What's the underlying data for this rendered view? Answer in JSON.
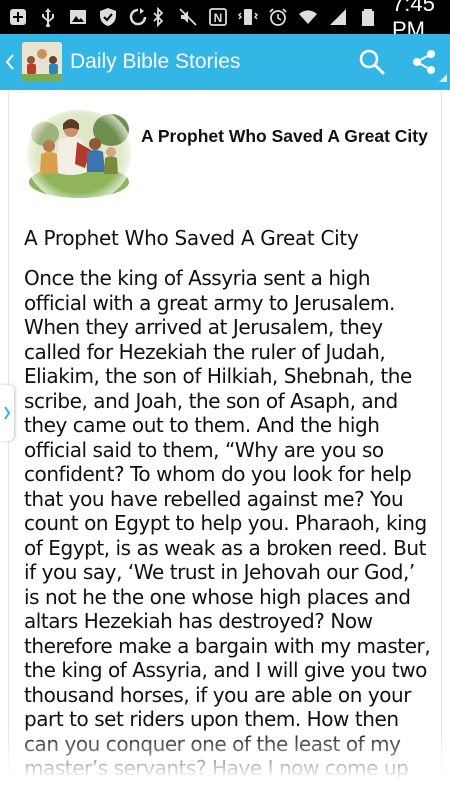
{
  "status_bar": {
    "time": "7:45 PM",
    "left_icons": [
      "add-icon",
      "usb-icon",
      "image-icon",
      "shield-icon",
      "sync-icon"
    ],
    "right_icons": [
      "bluetooth-icon",
      "mute-icon",
      "nfc-icon",
      "vibrate-icon",
      "alarm-icon",
      "wifi-icon",
      "signal-icon",
      "battery-icon"
    ]
  },
  "app_bar": {
    "title": "Daily Bible Stories",
    "background_color": "#33b5e5",
    "actions": [
      "search-icon",
      "share-icon"
    ]
  },
  "story": {
    "heading": "A Prophet Who Saved A Great City",
    "title": "A Prophet Who Saved A Great City",
    "body": "Once the king of Assyria sent a high official with a great army to Jerusalem. When they arrived at Jerusalem, they called for Hezekiah the ruler of Judah, Eliakim, the son of Hilkiah, Shebnah, the scribe, and Joah, the son of Asaph, and they came out to them. And the high official said to them, “Why are you so confident? To whom do you look for help that you have rebelled against me? You count on Egypt to help you. Pharaoh, king of Egypt, is as weak as a broken reed. But if you say, ‘We trust in Jehovah our God,’ is not he the one whose high places and altars Hezekiah has destroyed? Now therefore make a bargain with my master, the king of Assyria, and I will give you two thousand horses, if you are able on your part to set riders upon them. How then can you conquer one of the least of my master’s servants? Have I now come up against this place to destroy it without"
  }
}
